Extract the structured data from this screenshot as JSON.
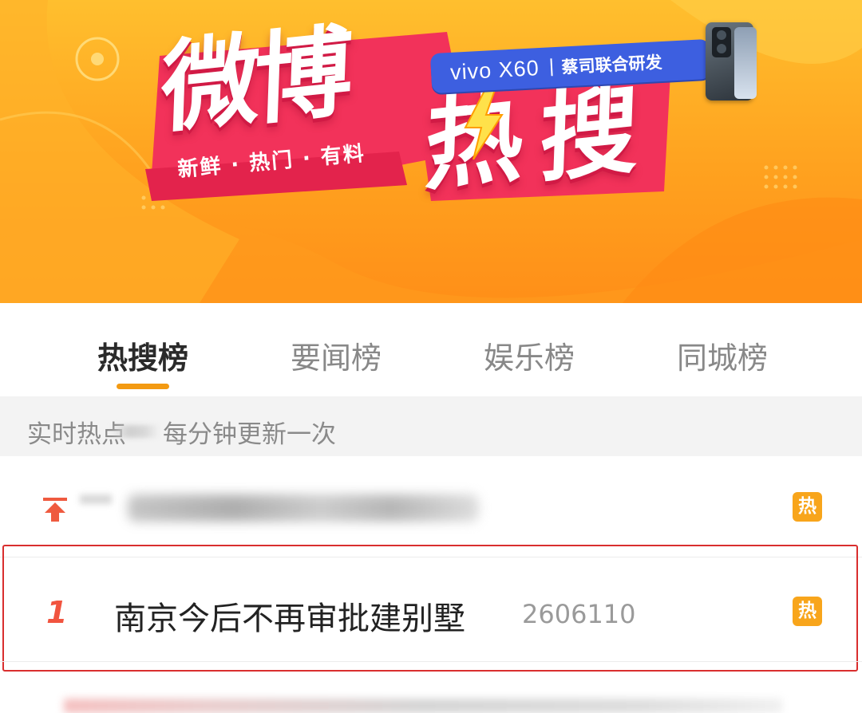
{
  "banner": {
    "title_chars": [
      "微",
      "博",
      "热",
      "搜"
    ],
    "subtitle": "新鲜 · 热门 · 有料",
    "brand_name": "vivo X60",
    "brand_partner": "蔡司联合研发"
  },
  "tabs": [
    {
      "label": "热搜榜",
      "active": true
    },
    {
      "label": "要闻榜",
      "active": false
    },
    {
      "label": "娱乐榜",
      "active": false
    },
    {
      "label": "同城榜",
      "active": false
    }
  ],
  "realtime": {
    "label": "实时热点",
    "text": "每分钟更新一次"
  },
  "list": {
    "pinned": {
      "icon": "pin-top-icon",
      "badge": "热"
    },
    "items": [
      {
        "rank": "1",
        "title": "南京今后不再审批建别墅",
        "count": "2606110",
        "badge": "热"
      }
    ]
  },
  "colors": {
    "accent": "#f39a12",
    "hot_badge": "#f8a51b",
    "rank": "#f1543f",
    "highlight": "#d92e2e"
  }
}
